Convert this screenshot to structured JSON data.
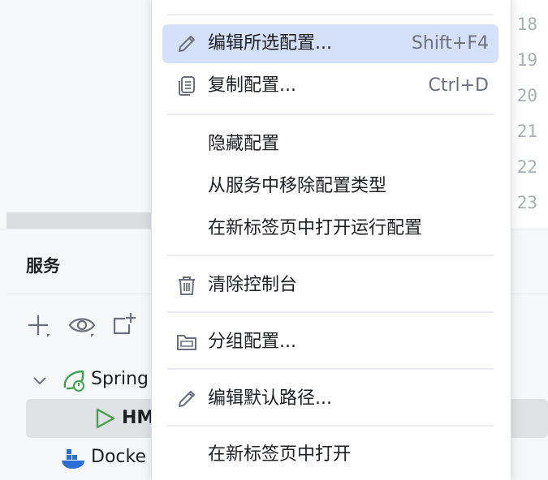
{
  "editor": {
    "line_numbers": [
      "18",
      "19",
      "20",
      "21",
      "22",
      "23"
    ]
  },
  "services": {
    "title": "服务",
    "toolbar_icons": [
      "add-icon",
      "eye-icon",
      "new-tab-icon"
    ],
    "tree": [
      {
        "label": "Spring",
        "icon": "spring-boot-icon",
        "expanded": true
      },
      {
        "label": "HM",
        "icon": "run-icon",
        "selected": true
      },
      {
        "label": "Docke",
        "icon": "docker-icon"
      }
    ]
  },
  "context_menu": {
    "items": [
      {
        "label": "编辑所选配置...",
        "shortcut": "Shift+F4",
        "icon": "pencil-icon",
        "active": true
      },
      {
        "label": "复制配置...",
        "shortcut": "Ctrl+D",
        "icon": "copy-icon"
      },
      {
        "label": "隐藏配置"
      },
      {
        "label": "从服务中移除配置类型"
      },
      {
        "label": "在新标签页中打开运行配置"
      },
      {
        "label": "清除控制台",
        "icon": "trash-icon"
      },
      {
        "label": "分组配置...",
        "icon": "folder-icon"
      },
      {
        "label": "编辑默认路径...",
        "icon": "pencil-icon"
      },
      {
        "label": "在新标签页中打开"
      }
    ]
  },
  "colors": {
    "menu_highlight": "#d5e1fb",
    "selection": "#dfe1e5",
    "spring_green": "#3aa64a",
    "run_green": "#44a34a",
    "docker_blue": "#2a6fd6"
  }
}
